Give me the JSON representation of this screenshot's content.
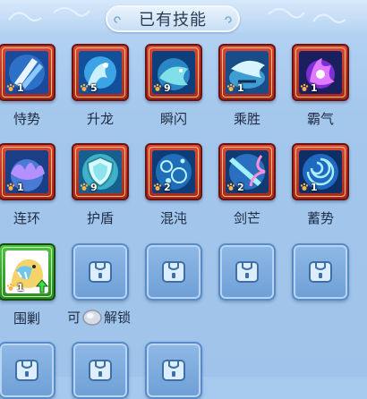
{
  "title": "已有技能",
  "skills": [
    {
      "name": "恃势",
      "level": "1",
      "icon": "crossed-blades-icon"
    },
    {
      "name": "升龙",
      "level": "5",
      "icon": "rising-dragon-icon"
    },
    {
      "name": "瞬闪",
      "level": "9",
      "icon": "flash-beast-icon"
    },
    {
      "name": "乘胜",
      "level": "1",
      "icon": "charging-beast-icon"
    },
    {
      "name": "霸气",
      "level": "1",
      "icon": "purple-aura-icon"
    },
    {
      "name": "连环",
      "level": "1",
      "icon": "chained-claws-icon"
    },
    {
      "name": "护盾",
      "level": "9",
      "icon": "shield-icon"
    },
    {
      "name": "混沌",
      "level": "2",
      "icon": "chaos-bubbles-icon"
    },
    {
      "name": "剑芒",
      "level": "2",
      "icon": "sword-light-icon"
    },
    {
      "name": "蓄势",
      "level": "1",
      "icon": "vortex-icon"
    },
    {
      "name": "围剿",
      "level": "1",
      "icon": "encircle-beast-icon",
      "upgradable": true
    }
  ],
  "unlock_hint": {
    "prefix": "可",
    "suffix": "解锁",
    "icon": "silver-coin-icon"
  },
  "locked_slot_icon": "lock-icon",
  "colors": {
    "frame_red": "#c23a30",
    "frame_green": "#3aa53a",
    "panel_blue": "#a6c9ee",
    "text_dark": "#1f2d44"
  }
}
